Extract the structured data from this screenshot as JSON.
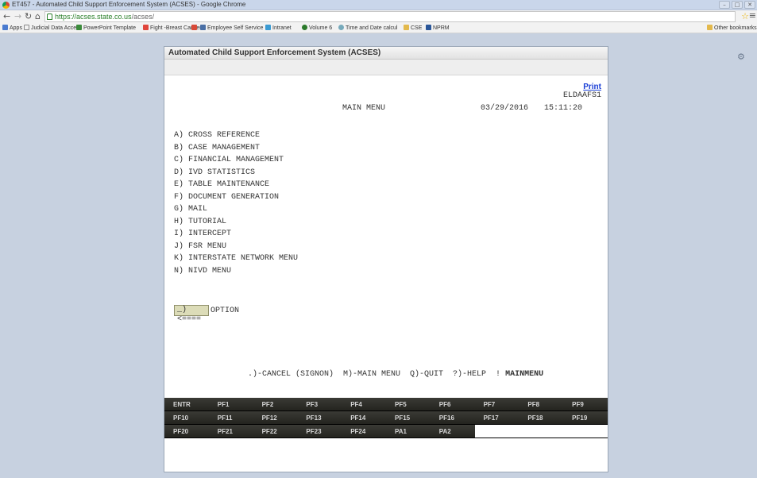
{
  "browser": {
    "window_title": "ET457 - Automated Child Support Enforcement System (ACSES) - Google Chrome",
    "url_host": "https://acses.state.co.us",
    "url_path": "/acses/",
    "bookmarks": [
      {
        "label": "Apps",
        "icon": "apps-grid-icon",
        "color": "#4a7bd0"
      },
      {
        "label": "Judicial Data Access",
        "icon": "page-icon",
        "color": "#ffffff"
      },
      {
        "label": "PowerPoint Template",
        "icon": "person-icon",
        "color": "#3b8b3b"
      },
      {
        "label": "Fight -Breast Cancer",
        "icon": "google-g-icon",
        "color": "#e0463c"
      },
      {
        "label": "",
        "icon": "gmail-icon",
        "color": "#d84a38"
      },
      {
        "label": "Employee Self Service",
        "icon": "window-icon",
        "color": "#4a6fa5"
      },
      {
        "label": "Intranet",
        "icon": "window-icon",
        "color": "#3b9bd3"
      },
      {
        "label": "Volume 6",
        "icon": "circle-icon",
        "color": "#2b7a2b"
      },
      {
        "label": "Time and Date calcul",
        "icon": "clock-icon",
        "color": "#7ab"
      },
      {
        "label": "CSE",
        "icon": "folder-icon",
        "color": "#e3b94c"
      },
      {
        "label": "NPRM",
        "icon": "doc-icon",
        "color": "#2a5699"
      }
    ],
    "other_bookmarks": "Other bookmarks"
  },
  "panel": {
    "title": "Automated Child Support Enforcement System (ACSES)"
  },
  "screen": {
    "print_label": "Print",
    "screen_id": "ELDAAFS1",
    "title": "MAIN MENU",
    "date": "03/29/2016",
    "time": "15:11:20",
    "menu_items": [
      "A) CROSS REFERENCE",
      "B) CASE MANAGEMENT",
      "C) FINANCIAL MANAGEMENT",
      "D) IVD STATISTICS",
      "E) TABLE MAINTENANCE",
      "F) DOCUMENT GENERATION",
      "G) MAIL",
      "H) TUTORIAL",
      "I) INTERCEPT",
      "J) FSR MENU",
      "K) INTERSTATE NETWORK MENU",
      "N) NIVD MENU"
    ],
    "option_value": "_) <====",
    "option_label": "OPTION",
    "footer_hints": ".)-CANCEL (SIGNON)  M)-MAIN MENU  Q)-QUIT  ?)-HELP  !",
    "footer_current": "MAINMENU"
  },
  "pf_keys": {
    "row1": [
      "ENTR",
      "PF1",
      "PF2",
      "PF3",
      "PF4",
      "PF5",
      "PF6",
      "PF7",
      "PF8",
      "PF9"
    ],
    "row2": [
      "PF10",
      "PF11",
      "PF12",
      "PF13",
      "PF14",
      "PF15",
      "PF16",
      "PF17",
      "PF18",
      "PF19"
    ],
    "row3": [
      "PF20",
      "PF21",
      "PF22",
      "PF23",
      "PF24",
      "PA1",
      "PA2"
    ]
  }
}
